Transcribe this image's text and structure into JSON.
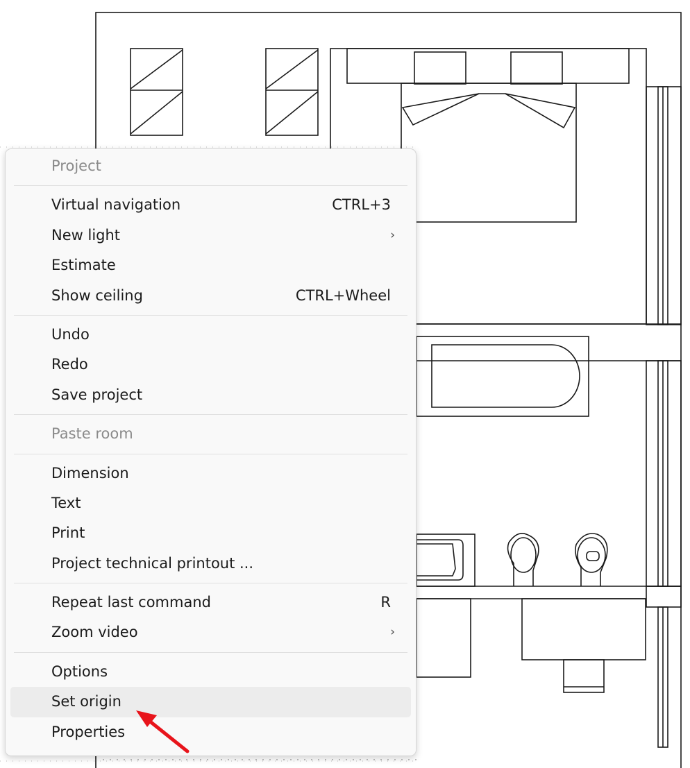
{
  "context_menu": {
    "items": [
      {
        "label": "Project",
        "shortcut": "",
        "submenu": false,
        "disabled": true
      },
      {
        "separator": true
      },
      {
        "label": "Virtual navigation",
        "shortcut": "CTRL+3",
        "submenu": false
      },
      {
        "label": "New light",
        "shortcut": "",
        "submenu": true
      },
      {
        "label": "Estimate",
        "shortcut": "",
        "submenu": false
      },
      {
        "label": "Show ceiling",
        "shortcut": "CTRL+Wheel",
        "submenu": false
      },
      {
        "separator": true
      },
      {
        "label": "Undo",
        "shortcut": "",
        "submenu": false
      },
      {
        "label": "Redo",
        "shortcut": "",
        "submenu": false
      },
      {
        "label": "Save project",
        "shortcut": "",
        "submenu": false
      },
      {
        "separator": true
      },
      {
        "label": "Paste room",
        "shortcut": "",
        "submenu": false,
        "disabled": true
      },
      {
        "separator": true
      },
      {
        "label": "Dimension",
        "shortcut": "",
        "submenu": false
      },
      {
        "label": "Text",
        "shortcut": "",
        "submenu": false
      },
      {
        "label": "Print",
        "shortcut": "",
        "submenu": false
      },
      {
        "label": "Project technical printout ...",
        "shortcut": "",
        "submenu": false
      },
      {
        "separator": true
      },
      {
        "label": "Repeat last command",
        "shortcut": "R",
        "submenu": false
      },
      {
        "label": "Zoom video",
        "shortcut": "",
        "submenu": true
      },
      {
        "separator": true
      },
      {
        "label": "Options",
        "shortcut": "",
        "submenu": false
      },
      {
        "label": "Set origin",
        "shortcut": "",
        "submenu": false,
        "highlighted": true
      },
      {
        "label": "Properties",
        "shortcut": "",
        "submenu": false
      }
    ],
    "submenu_glyph": "›"
  },
  "annotation": {
    "arrow_color": "#e8141b",
    "points_to": "Set origin"
  },
  "colors": {
    "menu_background": "#f9f9f9",
    "highlight": "#ececec",
    "disabled_text": "#8a8a8a",
    "drawing_lines": "#1a1a1a"
  }
}
